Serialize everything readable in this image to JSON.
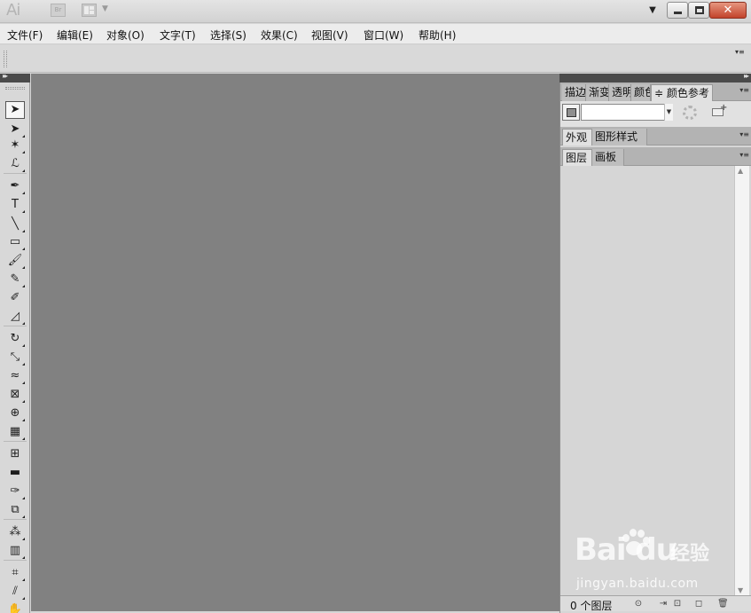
{
  "titlebar": {
    "app_logo": "Ai",
    "bridge_label": "Br",
    "workspace_caret": "▼",
    "close_glyph": "✕"
  },
  "menu": [
    {
      "label": "文件(F)"
    },
    {
      "label": "编辑(E)"
    },
    {
      "label": "对象(O)"
    },
    {
      "label": "文字(T)"
    },
    {
      "label": "选择(S)"
    },
    {
      "label": "效果(C)"
    },
    {
      "label": "视图(V)"
    },
    {
      "label": "窗口(W)"
    },
    {
      "label": "帮助(H)"
    }
  ],
  "tools": [
    {
      "name": "selection-tool-icon",
      "glyph": "➤",
      "active": true
    },
    {
      "name": "direct-selection-tool-icon",
      "glyph": "➤"
    },
    {
      "name": "magic-wand-tool-icon",
      "glyph": "✶"
    },
    {
      "name": "lasso-tool-icon",
      "glyph": "ℒ"
    },
    {
      "name": "pen-tool-icon",
      "glyph": "✒"
    },
    {
      "name": "type-tool-icon",
      "glyph": "T"
    },
    {
      "name": "line-segment-tool-icon",
      "glyph": "╲"
    },
    {
      "name": "rectangle-tool-icon",
      "glyph": "▭"
    },
    {
      "name": "paintbrush-tool-icon",
      "glyph": "🖌"
    },
    {
      "name": "pencil-tool-icon",
      "glyph": "✎"
    },
    {
      "name": "blob-brush-tool-icon",
      "glyph": "✐"
    },
    {
      "name": "eraser-tool-icon",
      "glyph": "◿"
    },
    {
      "name": "rotate-tool-icon",
      "glyph": "↻"
    },
    {
      "name": "scale-tool-icon",
      "glyph": "⤡"
    },
    {
      "name": "warp-tool-icon",
      "glyph": "≈"
    },
    {
      "name": "free-transform-tool-icon",
      "glyph": "⊠"
    },
    {
      "name": "shape-builder-tool-icon",
      "glyph": "⊕"
    },
    {
      "name": "perspective-grid-tool-icon",
      "glyph": "▦"
    },
    {
      "name": "mesh-tool-icon",
      "glyph": "⊞"
    },
    {
      "name": "gradient-tool-icon",
      "glyph": "▬"
    },
    {
      "name": "eyedropper-tool-icon",
      "glyph": "✑"
    },
    {
      "name": "blend-tool-icon",
      "glyph": "⧉"
    },
    {
      "name": "symbol-sprayer-tool-icon",
      "glyph": "⁂"
    },
    {
      "name": "column-graph-tool-icon",
      "glyph": "▥"
    },
    {
      "name": "artboard-tool-icon",
      "glyph": "⌗"
    },
    {
      "name": "slice-tool-icon",
      "glyph": "⫽"
    },
    {
      "name": "hand-tool-icon",
      "glyph": "✋"
    }
  ],
  "panels": {
    "color_group": {
      "tabs": [
        "描边",
        "渐变",
        "透明度",
        "颜色",
        "颜色参考"
      ],
      "active_tab_prefix": "≑",
      "menu_glyph": "▾≡"
    },
    "appearance_group": {
      "tabs": [
        "外观",
        "图形样式"
      ],
      "menu_glyph": "▾≡"
    },
    "layers_group": {
      "tabs": [
        "图层",
        "画板"
      ],
      "menu_glyph": "▾≡",
      "layer_count": "0 个图层"
    }
  },
  "header_collapse_glyph": "▸▸",
  "control_menu_glyph": "▾≡",
  "watermark": {
    "logo": "Bai du",
    "cn": "经验",
    "url": "jingyan.baidu.com"
  },
  "colors": {
    "canvas": "#818181",
    "panel_header": "#4b4b4b",
    "close_button": "#c2432b"
  }
}
